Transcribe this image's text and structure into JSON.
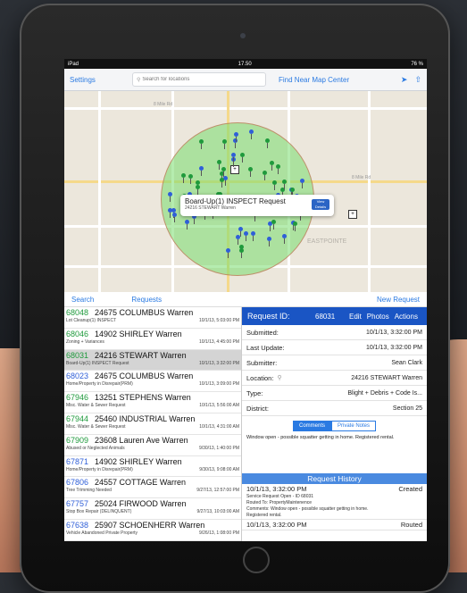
{
  "status": {
    "carrier": "iPad",
    "time": "17.50",
    "battery": "76 %"
  },
  "toolbar": {
    "settings": "Settings",
    "search_placeholder": "Search for locations",
    "find": "Find Near Map Center"
  },
  "map": {
    "street_labels": [
      "8 Mile Rd",
      "8 Mile Rd",
      "EASTPOINTE"
    ],
    "callout": {
      "title": "Board-Up(1) INSPECT Request",
      "subtitle": "24216 STEWART Warren",
      "button": "View Details"
    }
  },
  "tabs": {
    "search": "Search",
    "requests": "Requests",
    "new_request": "New Request"
  },
  "requests": [
    {
      "id": "68048",
      "address": "24675 COLUMBUS Warren",
      "type": "Lot Cleanup(1) INSPECT",
      "date": "10/1/13, 5:03:00 PM",
      "color": "#1f9a3c"
    },
    {
      "id": "68046",
      "address": "14902 SHIRLEY Warren",
      "type": "Zoning + Variances",
      "date": "10/1/13, 4:45:00 PM",
      "color": "#1f9a3c"
    },
    {
      "id": "68031",
      "address": "24216 STEWART Warren",
      "type": "Board-Up(1) INSPECT Request",
      "date": "10/1/13, 3:32:00 PM",
      "color": "#1f9a3c"
    },
    {
      "id": "68023",
      "address": "24675 COLUMBUS Warren",
      "type": "Home/Property in Disrepair(PRM)",
      "date": "10/1/13, 3:09:00 PM",
      "color": "#2f5fd8"
    },
    {
      "id": "67946",
      "address": "13251 STEPHENS Warren",
      "type": "Misc. Water & Sewer Request",
      "date": "10/1/13, 5:56:00 AM",
      "color": "#1f9a3c"
    },
    {
      "id": "67944",
      "address": "25460 INDUSTRIAL Warren",
      "type": "Misc. Water & Sewer Request",
      "date": "10/1/13, 4:31:00 AM",
      "color": "#1f9a3c"
    },
    {
      "id": "67909",
      "address": "23608 Lauren Ave Warren",
      "type": "Abused or Neglected Animals",
      "date": "9/30/13, 1:40:00 PM",
      "color": "#1f9a3c"
    },
    {
      "id": "67871",
      "address": "14902 SHIRLEY Warren",
      "type": "Home/Property in Disrepair(PRM)",
      "date": "9/30/13, 9:08:00 AM",
      "color": "#2f5fd8"
    },
    {
      "id": "67806",
      "address": "24557 COTTAGE Warren",
      "type": "Tree Trimming Needed",
      "date": "9/27/13, 12:57:00 PM",
      "color": "#2f5fd8"
    },
    {
      "id": "67757",
      "address": "25024 FIRWOOD Warren",
      "type": "Stop Box Repair (DELINQUENT)",
      "date": "9/27/13, 10:03:00 AM",
      "color": "#2f5fd8"
    },
    {
      "id": "67638",
      "address": "25907 SCHOENHERR Warren",
      "type": "Vehicle Abandoned Private Property",
      "date": "9/26/13, 1:08:00 PM",
      "color": "#2f5fd8"
    }
  ],
  "detail": {
    "header_label": "Request ID:",
    "id": "68031",
    "actions": [
      "Edit",
      "Photos",
      "Actions"
    ],
    "fields": [
      {
        "label": "Submitted:",
        "value": "10/1/13, 3:32:00 PM"
      },
      {
        "label": "Last Update:",
        "value": "10/1/13, 3:32:00 PM"
      },
      {
        "label": "Submitter:",
        "value": "Sean  Clark"
      },
      {
        "label": "Location:",
        "value": "24216 STEWART Warren"
      },
      {
        "label": "Type:",
        "value": "Blight + Debris + Code Is..."
      },
      {
        "label": "District:",
        "value": "Section 25"
      }
    ],
    "segments": [
      "Comments",
      "Private Notes"
    ],
    "comment": "Window open - possible squatter getting in home. Registered rental.",
    "history_title": "Request History",
    "history": [
      {
        "date": "10/1/13, 3:32:00 PM",
        "status": "Created",
        "details": [
          "Service Request Open - ID 68031",
          "Routed To: PropertyMaintenence",
          "Comments: Window open - possible squatter getting in home.",
          "Registered rental."
        ]
      },
      {
        "date": "10/1/13, 3:32:00 PM",
        "status": "Routed",
        "details": []
      }
    ]
  }
}
